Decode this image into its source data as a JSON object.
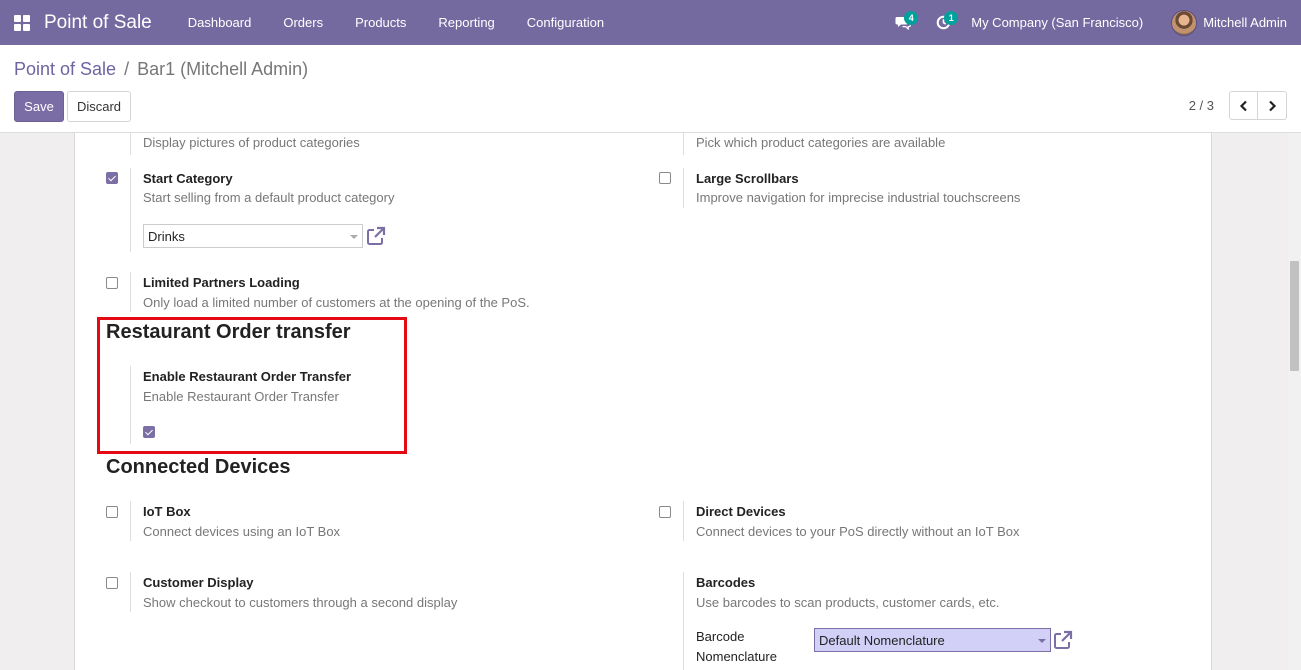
{
  "navbar": {
    "brand": "Point of Sale",
    "menu": [
      "Dashboard",
      "Orders",
      "Products",
      "Reporting",
      "Configuration"
    ],
    "messages_count": "4",
    "activities_count": "1",
    "company": "My Company (San Francisco)",
    "user": "Mitchell Admin"
  },
  "breadcrumb": {
    "parent": "Point of Sale",
    "separator": "/",
    "current": "Bar1 (Mitchell Admin)"
  },
  "toolbar": {
    "save_label": "Save",
    "discard_label": "Discard",
    "pager": "2 / 3"
  },
  "settings": {
    "top_left_desc": "Display pictures of product categories",
    "top_right_desc": "Pick which product categories are available",
    "start_category": {
      "title": "Start Category",
      "desc": "Start selling from a default product category",
      "checked": true,
      "value": "Drinks"
    },
    "large_scrollbars": {
      "title": "Large Scrollbars",
      "desc": "Improve navigation for imprecise industrial touchscreens",
      "checked": false
    },
    "limited_partners": {
      "title": "Limited Partners Loading",
      "desc": "Only load a limited number of customers at the opening of the PoS.",
      "checked": false
    }
  },
  "restaurant": {
    "heading": "Restaurant Order transfer",
    "title": "Enable Restaurant Order Transfer",
    "desc": "Enable Restaurant Order Transfer",
    "checked": true
  },
  "devices": {
    "heading": "Connected Devices",
    "iot_box": {
      "title": "IoT Box",
      "desc": "Connect devices using an IoT Box",
      "checked": false
    },
    "direct_devices": {
      "title": "Direct Devices",
      "desc": "Connect devices to your PoS directly without an IoT Box",
      "checked": false
    },
    "customer_display": {
      "title": "Customer Display",
      "desc": "Show checkout to customers through a second display",
      "checked": false
    },
    "barcodes": {
      "title": "Barcodes",
      "desc": "Use barcodes to scan products, customer cards, etc.",
      "label_line1": "Barcode",
      "label_line2": "Nomenclature",
      "value": "Default Nomenclature"
    }
  },
  "colors": {
    "brand": "#756aa0",
    "accent": "#7c6fa5",
    "highlight": "#e50914",
    "badge": "#00a09d"
  },
  "icons": {
    "apps": "apps-grid-icon",
    "messages": "chat-icon",
    "activities": "clock-icon",
    "external": "external-link-icon",
    "prev": "chevron-left-icon",
    "next": "chevron-right-icon"
  }
}
